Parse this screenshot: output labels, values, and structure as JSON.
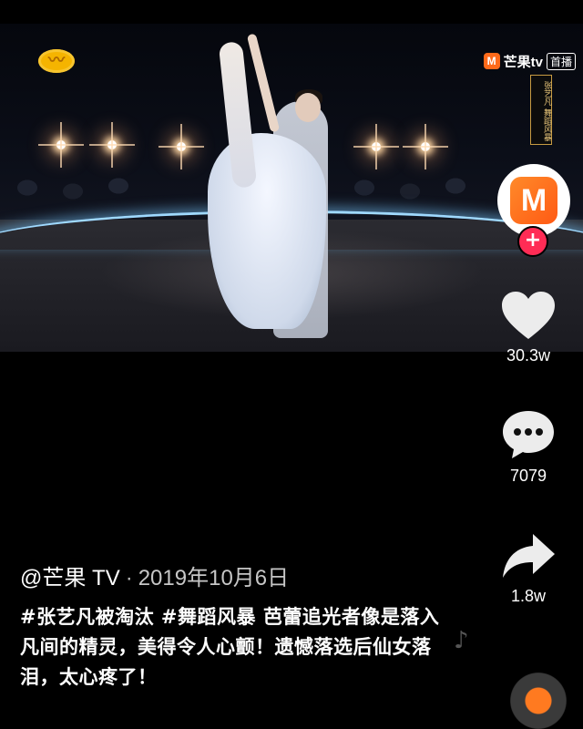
{
  "video": {
    "broadcaster_logo": "hunan-tv-logo",
    "brand": {
      "mark": "M",
      "name": "芒果tv",
      "badge": "首播"
    },
    "show_banner": "张艺凡 舞蹈风暴"
  },
  "rail": {
    "avatar_letter": "M",
    "follow_label": "+",
    "likes": "30.3w",
    "comments": "7079",
    "shares": "1.8w"
  },
  "caption": {
    "author": "@芒果 TV",
    "separator": "·",
    "date": "2019年10月6日",
    "hashtags": "#张艺凡被淘汰 #舞蹈风暴",
    "text": " 芭蕾追光者像是落入凡间的精灵，美得令人心颤！遗憾落选后仙女落泪，太心疼了！"
  },
  "colors": {
    "background": "#000000",
    "follow_button": "#ff2c55",
    "brand_orange": "#ff6a1a"
  }
}
